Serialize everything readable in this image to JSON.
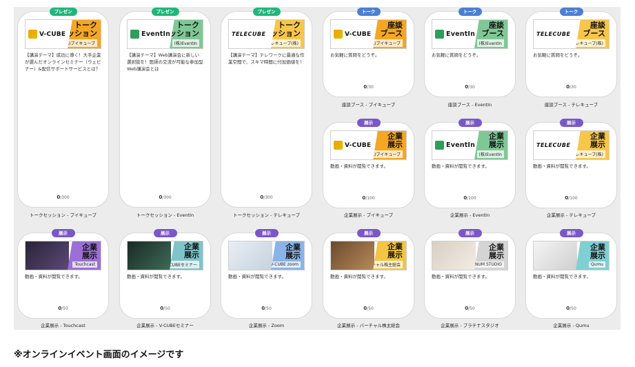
{
  "badges": {
    "present": "プレゼン",
    "talk": "トーク",
    "exhibit": "展示"
  },
  "cards": [
    {
      "id": "c1",
      "badge": "プレゼン",
      "logo": "V-CUBE",
      "tag_title": "トーク\nセッション",
      "tag_sub": "(株)ブイキューブ",
      "desc": "【講演テーマ】成功に導く！大手企業が選んだオンラインセミナー（ウェビナー）&配信サポートサービスとは？",
      "count": "0",
      "max": "/300",
      "caption": "トークセッション - ブイキューブ"
    },
    {
      "id": "c2",
      "badge": "プレゼン",
      "logo": "EventIn",
      "tag_title": "トーク\nセッション",
      "tag_sub": "(株)EventIn",
      "desc": "【講演テーマ】Web講演会に新しい選択肢を！医師の交流が可能な参加型Web講演会とは",
      "count": "0",
      "max": "/300",
      "caption": "トークセッション - EventIn"
    },
    {
      "id": "c3",
      "badge": "プレゼン",
      "logo": "TELECUBE",
      "tag_title": "トーク\nセッション",
      "tag_sub": "テレキューブ(株)",
      "desc": "【講演テーマ】テレワークに最適な作業空間で、スキマ時間に付加価値を！",
      "count": "0",
      "max": "/300",
      "caption": "トークセッション - テレキューブ"
    },
    {
      "id": "c4",
      "badge": "トーク",
      "logo": "V-CUBE",
      "tag_title": "座談\nブース",
      "tag_sub": "(株)ブイキューブ",
      "desc": "お気軽に質問をどうぞ。",
      "count": "0",
      "max": "/30",
      "caption": "座談ブース - ブイキューブ"
    },
    {
      "id": "c5",
      "badge": "トーク",
      "logo": "EventIn",
      "tag_title": "座談\nブース",
      "tag_sub": "(株)EventIn",
      "desc": "お気軽に質問をどうぞ。",
      "count": "0",
      "max": "/30",
      "caption": "座談ブース - EventIn"
    },
    {
      "id": "c6",
      "badge": "トーク",
      "logo": "TELECUBE",
      "tag_title": "座談\nブース",
      "tag_sub": "テレキューブ(株)",
      "desc": "お気軽に質問をどうぞ。",
      "count": "0",
      "max": "/30",
      "caption": "座談ブース - テレキューブ"
    },
    {
      "id": "c7",
      "badge": "展示",
      "logo": "V-CUBE",
      "tag_title": "企業\n展示",
      "tag_sub": "(株)ブイキューブ",
      "desc": "動画・資料が閲覧できます。",
      "count": "0",
      "max": "/100",
      "caption": "企業展示 - ブイキューブ"
    },
    {
      "id": "c8",
      "badge": "展示",
      "logo": "EventIn",
      "tag_title": "企業\n展示",
      "tag_sub": "(株)EventIn",
      "desc": "動画・資料が閲覧できます。",
      "count": "0",
      "max": "/100",
      "caption": "企業展示 - EventIn"
    },
    {
      "id": "c9",
      "badge": "展示",
      "logo": "TELECUBE",
      "tag_title": "企業\n展示",
      "tag_sub": "テレキューブ(株)",
      "desc": "動画・資料が閲覧できます。",
      "count": "0",
      "max": "/100",
      "caption": "企業展示 - テレキューブ"
    },
    {
      "id": "c10",
      "badge": "展示",
      "logo": "",
      "tag_title": "企業\n展示",
      "tag_sub": "Touchcast",
      "desc": "動画・資料が閲覧できます。",
      "count": "0",
      "max": "/50",
      "caption": "企業展示 - Touchcast"
    },
    {
      "id": "c11",
      "badge": "展示",
      "logo": "",
      "tag_title": "企業\n展示",
      "tag_sub": "V-CUBEセミナー",
      "desc": "動画・資料が閲覧できます。",
      "count": "0",
      "max": "/50",
      "caption": "企業展示 - V-CUBEセミナー"
    },
    {
      "id": "c12",
      "badge": "展示",
      "logo": "",
      "tag_title": "企業\n展示",
      "tag_sub": "V-CUBE zoom",
      "desc": "動画・資料が閲覧できます。",
      "count": "0",
      "max": "/50",
      "caption": "企業展示 - Zoom"
    },
    {
      "id": "c13",
      "badge": "展示",
      "logo": "",
      "tag_title": "企業\n展示",
      "tag_sub": "バーチャル株主総会",
      "desc": "動画・資料が閲覧できます。",
      "count": "0",
      "max": "/50",
      "caption": "企業展示 - バーチャル株主総会"
    },
    {
      "id": "c14",
      "badge": "展示",
      "logo": "",
      "tag_title": "企業\n展示",
      "tag_sub": "PLATINUM STUDIO",
      "desc": "動画・資料が閲覧できます。",
      "count": "0",
      "max": "/50",
      "caption": "企業展示 - プラチナスタジオ"
    },
    {
      "id": "c15",
      "badge": "展示",
      "logo": "",
      "tag_title": "企業\n展示",
      "tag_sub": "Qumu",
      "desc": "動画・資料が閲覧できます。",
      "count": "0",
      "max": "/50",
      "caption": "企業展示 - Qumu"
    }
  ],
  "colors": {
    "present": "#1fb67c",
    "talk": "#4a7fd3",
    "exhibit": "#7a57c8",
    "board": "#ececec"
  },
  "footnote": "※オンラインイベント画面のイメージです"
}
